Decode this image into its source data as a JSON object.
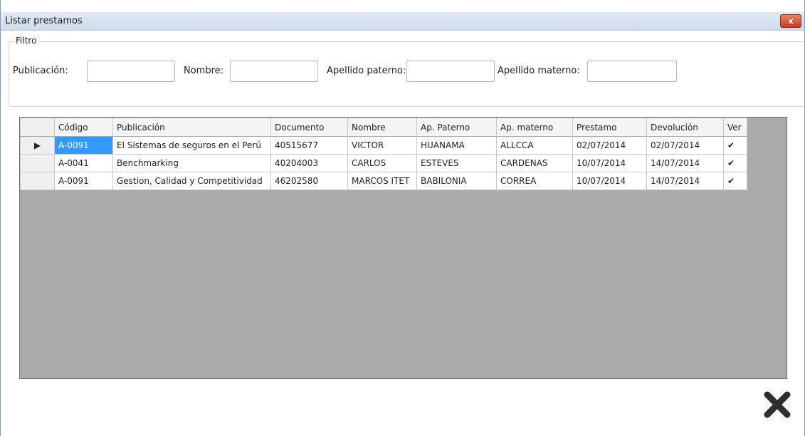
{
  "window": {
    "title": "Listar prestamos",
    "close_glyph": "x"
  },
  "filter": {
    "legend": "Filtro",
    "fields": [
      {
        "label": "Publicación:",
        "value": ""
      },
      {
        "label": "Nombre:",
        "value": ""
      },
      {
        "label": "Apellido paterno:",
        "value": ""
      },
      {
        "label": "Apellido materno:",
        "value": ""
      }
    ]
  },
  "grid": {
    "columns": [
      "Código",
      "Publicación",
      "Documento",
      "Nombre",
      "Ap. Paterno",
      "Ap. materno",
      "Prestamo",
      "Devolución",
      "Ver"
    ],
    "rows": [
      {
        "indicator": "▶",
        "cells": [
          "A-0091",
          "El Sistemas de seguros en el Perú",
          "40515677",
          "VICTOR",
          "HUANAMA",
          "ALLCCA",
          "02/07/2014",
          "02/07/2014"
        ],
        "view": "✔"
      },
      {
        "indicator": "",
        "cells": [
          "A-0041",
          "Benchmarking",
          "40204003",
          "CARLOS",
          "ESTEVES",
          "CARDENAS",
          "10/07/2014",
          "14/07/2014"
        ],
        "view": "✔"
      },
      {
        "indicator": "",
        "cells": [
          "A-0091",
          "Gestion, Calidad y Competitividad",
          "46202580",
          "MARCOS ITET",
          "BABILONIA",
          "CORREA",
          "10/07/2014",
          "14/07/2014"
        ],
        "view": "✔"
      }
    ]
  },
  "footer": {
    "close_icon": "close-x-icon"
  },
  "colors": {
    "selection": "#3399ff",
    "grid_background": "#aaaaaa"
  }
}
